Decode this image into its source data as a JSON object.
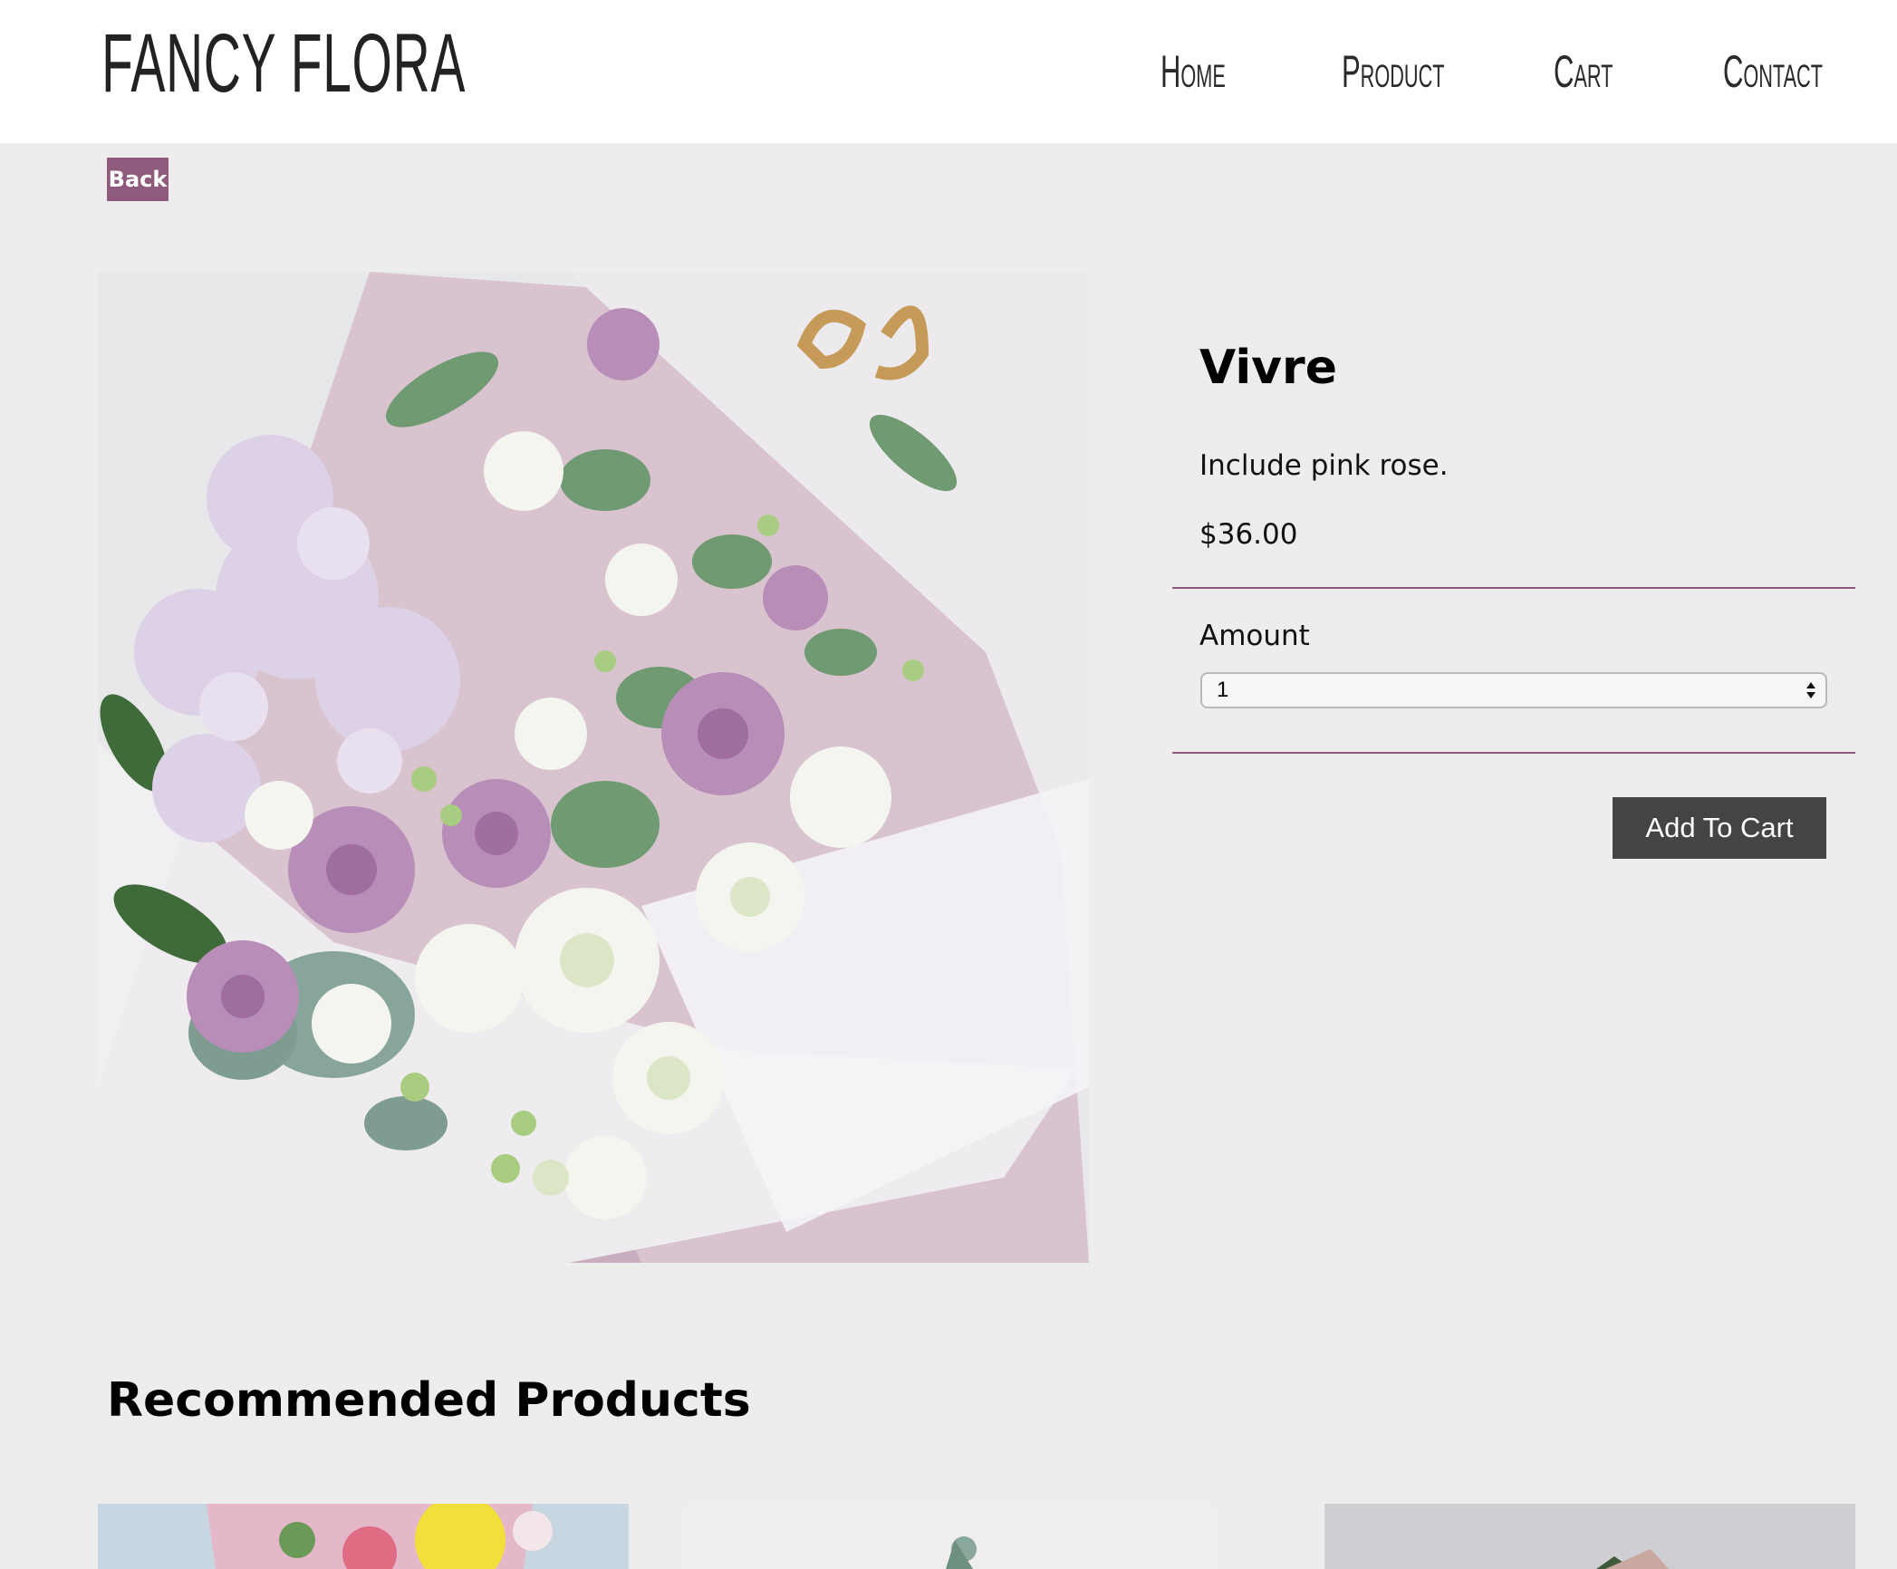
{
  "header": {
    "logo": "FANCY FLORA",
    "nav": [
      "Home",
      "Product",
      "Cart",
      "Contact"
    ]
  },
  "back_label": "Back",
  "product": {
    "title": "Vivre",
    "description": "Include pink rose.",
    "price": "$36.00",
    "amount_label": "Amount",
    "amount_value": "1",
    "add_to_cart_label": "Add To Cart"
  },
  "recommended": {
    "heading": "Recommended Products",
    "items": [
      "bouquet-yellow-pink",
      "bouquet-white-green",
      "bouquet-grey-pink"
    ]
  },
  "colors": {
    "accent": "#8f5b7d",
    "button_dark": "#444444",
    "page_bg": "#ededed",
    "header_bg": "#ffffff"
  }
}
